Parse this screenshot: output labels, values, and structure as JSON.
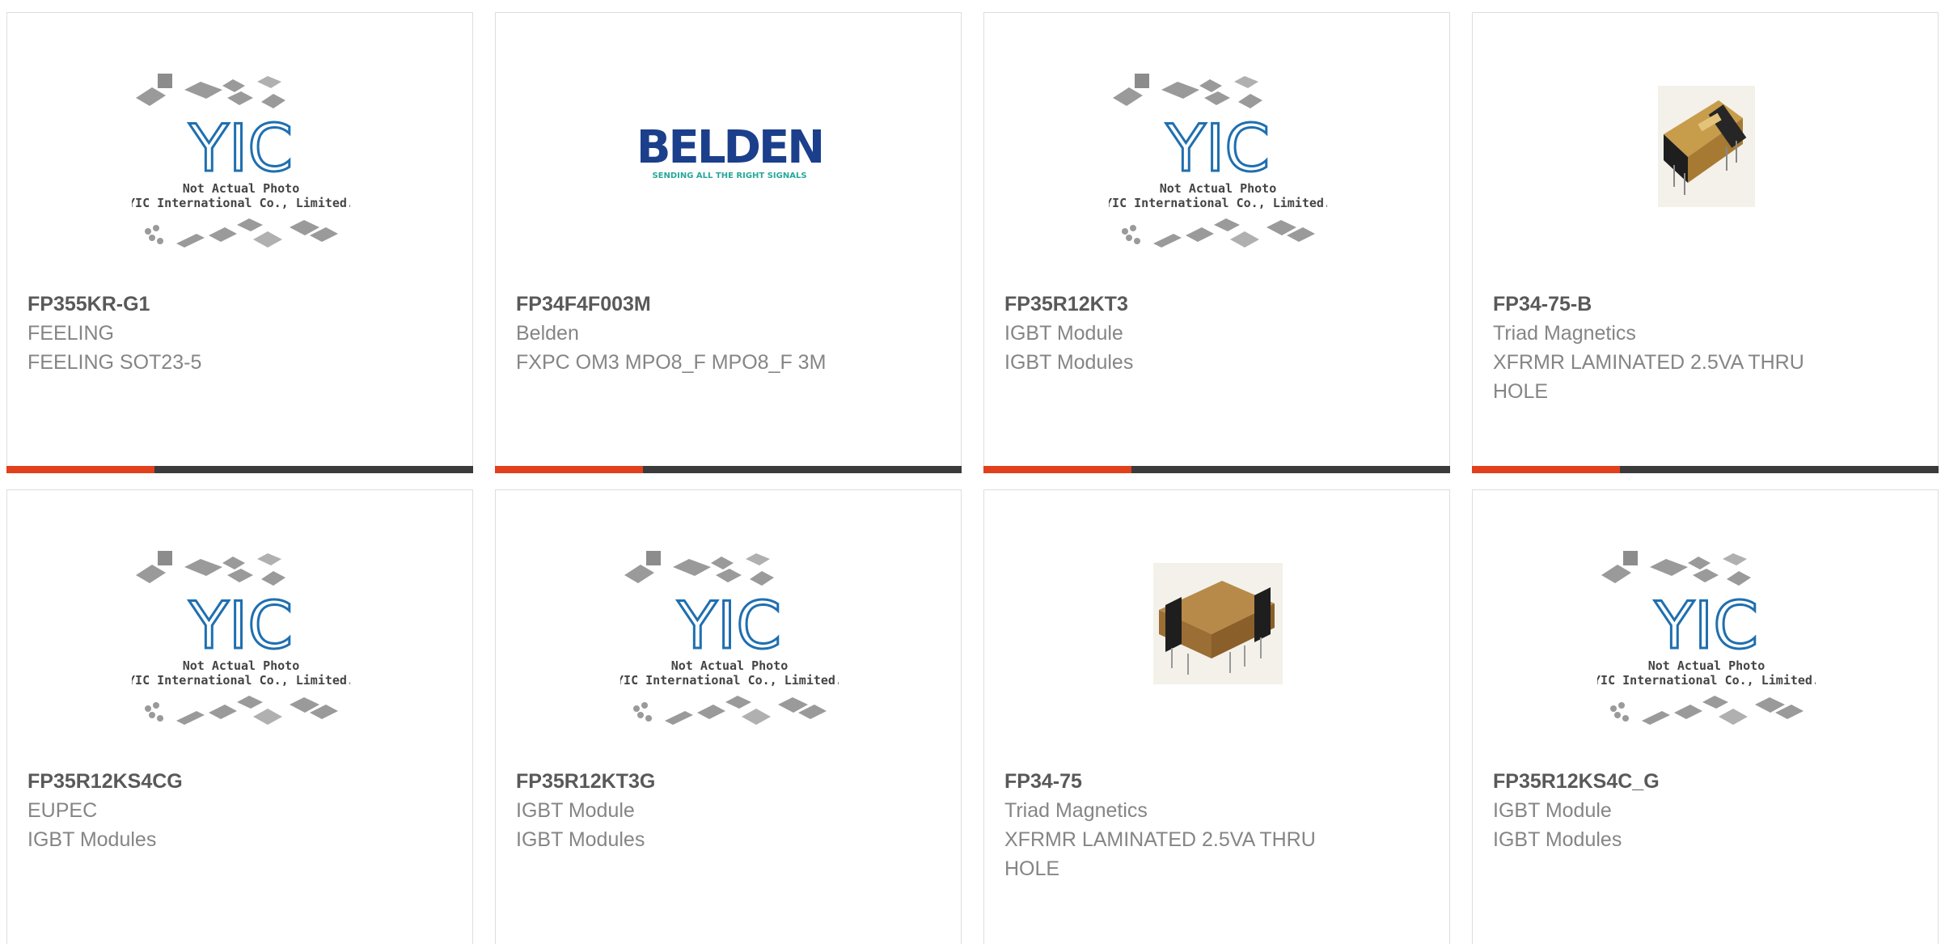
{
  "colors": {
    "accent_orange": "#e2401d",
    "bar_dark": "#3b3b3b",
    "part_number_text": "#595959",
    "secondary_text": "#858585",
    "yic_logo_blue": "#1f6fb0",
    "belden_navy": "#1c3f8c",
    "belden_teal": "#27a89a"
  },
  "placeholder_image": {
    "line1": "Not Actual Photo",
    "line2": "YIC International Co., Limited."
  },
  "belden_logo": {
    "wordmark": "BELDEN",
    "tagline": "SENDING ALL THE RIGHT SIGNALS"
  },
  "products": [
    {
      "image": "yic-placeholder",
      "part_number": "FP355KR-G1",
      "manufacturer": "FEELING",
      "description": "FEELING SOT23-5"
    },
    {
      "image": "belden-logo",
      "part_number": "FP34F4F003M",
      "manufacturer": "Belden",
      "description": "FXPC OM3 MPO8_F MPO8_F 3M"
    },
    {
      "image": "yic-placeholder",
      "part_number": "FP35R12KT3",
      "manufacturer": "IGBT Module",
      "description": "IGBT Modules"
    },
    {
      "image": "transformer-photo",
      "part_number": "FP34-75-B",
      "manufacturer": "Triad Magnetics",
      "description": "XFRMR LAMINATED 2.5VA THRU HOLE"
    },
    {
      "image": "yic-placeholder",
      "part_number": "FP35R12KS4CG",
      "manufacturer": "EUPEC",
      "description": "IGBT Modules"
    },
    {
      "image": "yic-placeholder",
      "part_number": "FP35R12KT3G",
      "manufacturer": "IGBT Module",
      "description": "IGBT Modules"
    },
    {
      "image": "transformer-photo",
      "part_number": "FP34-75",
      "manufacturer": "Triad Magnetics",
      "description": "XFRMR LAMINATED 2.5VA THRU HOLE"
    },
    {
      "image": "yic-placeholder",
      "part_number": "FP35R12KS4C_G",
      "manufacturer": "IGBT Module",
      "description": "IGBT Modules"
    }
  ]
}
